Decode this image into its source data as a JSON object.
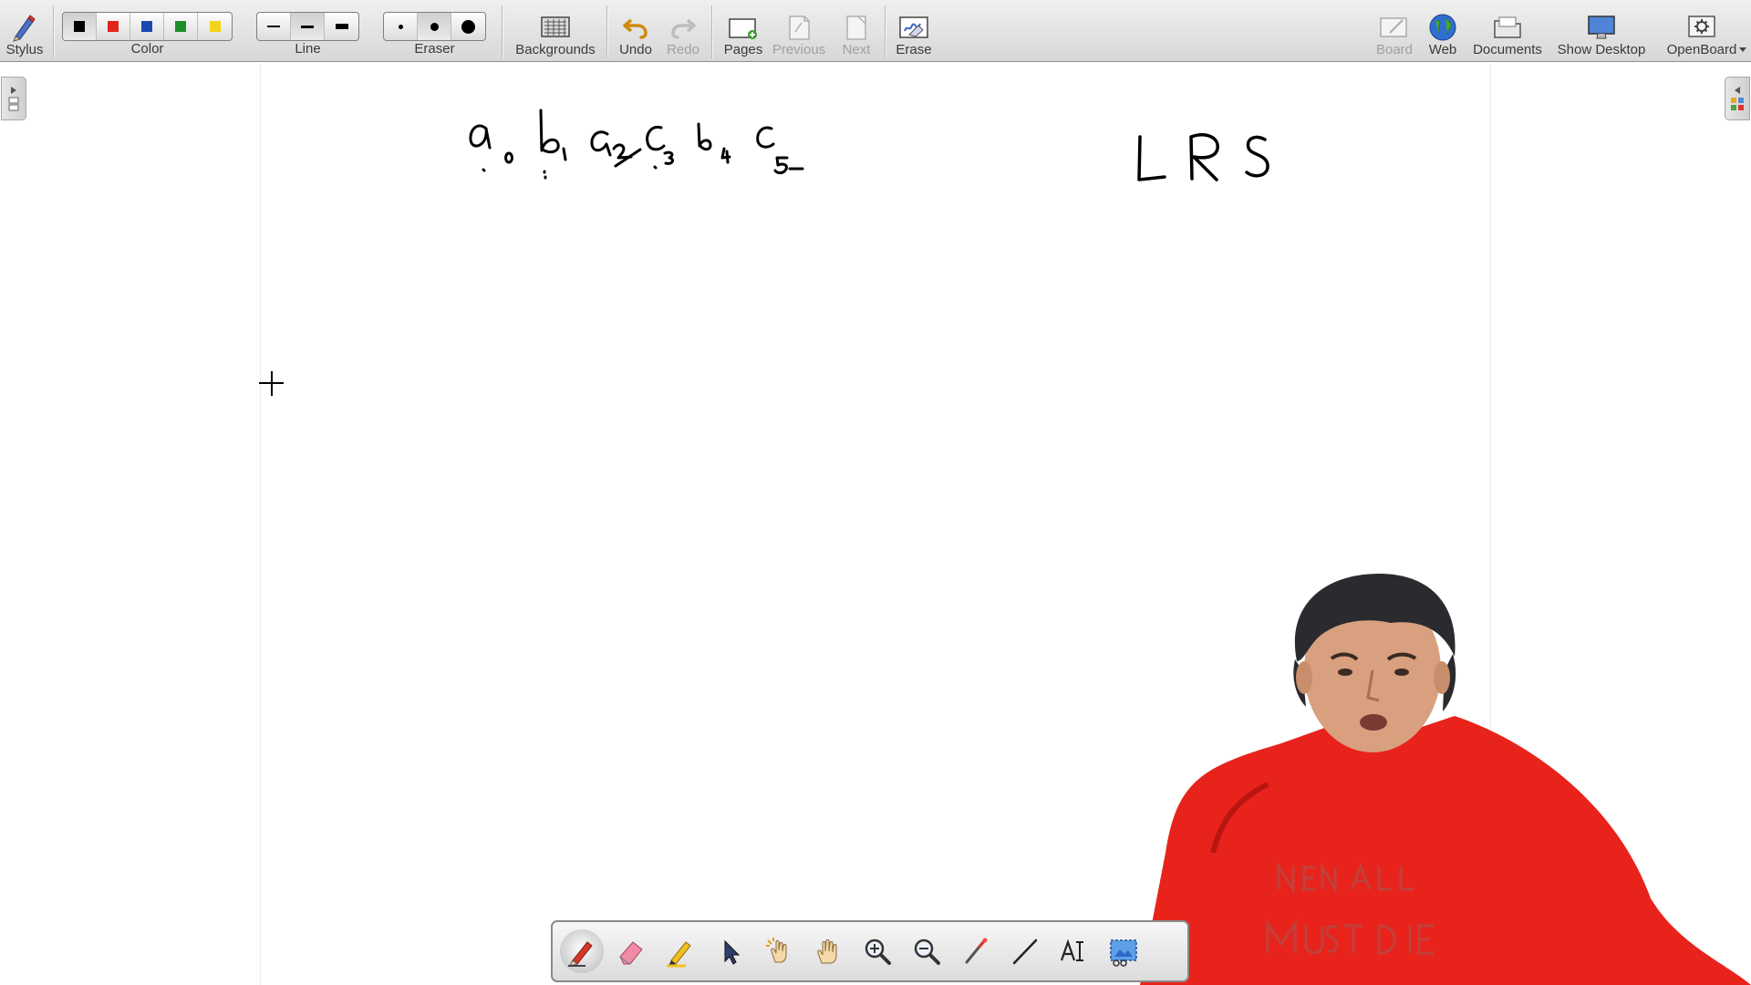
{
  "toolbar": {
    "stylus": "Stylus",
    "color_group": "Color",
    "line_group": "Line",
    "eraser_group": "Eraser",
    "backgrounds": "Backgrounds",
    "undo": "Undo",
    "redo": "Redo",
    "pages": "Pages",
    "previous": "Previous",
    "next": "Next",
    "erase": "Erase",
    "board": "Board",
    "web": "Web",
    "documents": "Documents",
    "show_desktop": "Show Desktop",
    "openboard": "OpenBoard"
  },
  "colors": [
    "#000000",
    "#e3261b",
    "#1b47b0",
    "#1e8e2a",
    "#f2d21b"
  ],
  "active_color_index": 0,
  "line_widths": [
    "thin",
    "medium",
    "thick"
  ],
  "active_line_index": 1,
  "eraser_sizes": [
    "small",
    "medium",
    "large"
  ],
  "active_eraser_index": 1,
  "board": {
    "handwriting_line1": "a0 b1 a2 c3 b4 c5",
    "handwriting_line2": "L R S"
  },
  "bottom_tools": [
    "pen-icon",
    "eraser-icon",
    "highlighter-icon",
    "selector-icon",
    "interact-icon",
    "hand-icon",
    "zoom-in-icon",
    "zoom-out-icon",
    "laser-pointer-icon",
    "line-icon",
    "text-icon",
    "capture-icon"
  ],
  "active_tool": "pen-icon"
}
